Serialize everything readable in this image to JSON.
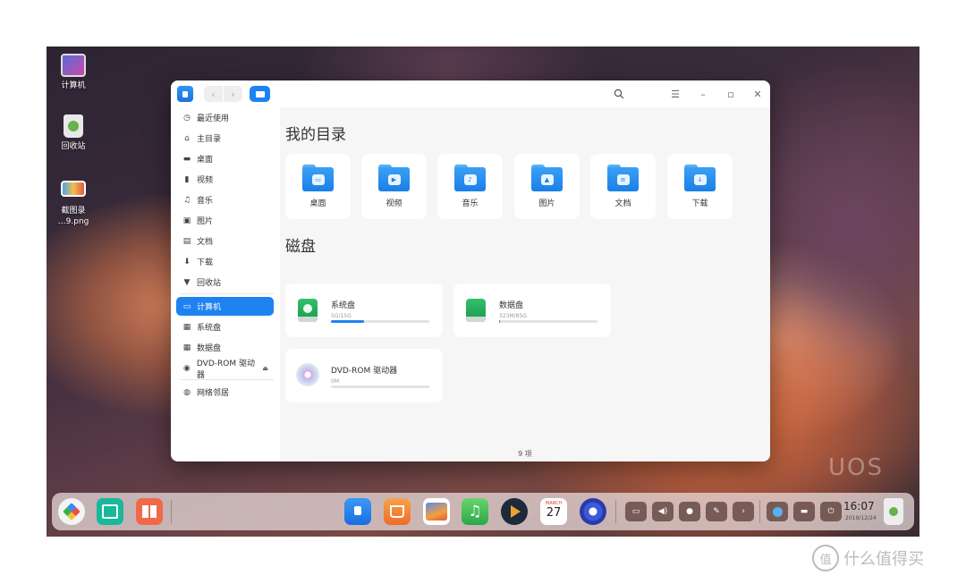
{
  "desktop": {
    "icons": [
      {
        "label": "计算机"
      },
      {
        "label": "回收站"
      },
      {
        "label": "截图录",
        "label2": "…9.png"
      }
    ],
    "brand": "UOS"
  },
  "window": {
    "search_icon": "search-icon",
    "sidebar": [
      {
        "label": "最近使用",
        "icon": "clock-icon"
      },
      {
        "label": "主目录",
        "icon": "home-icon"
      },
      {
        "label": "桌面",
        "icon": "desktop-icon"
      },
      {
        "label": "视频",
        "icon": "video-icon"
      },
      {
        "label": "音乐",
        "icon": "music-icon"
      },
      {
        "label": "图片",
        "icon": "picture-icon"
      },
      {
        "label": "文档",
        "icon": "document-icon"
      },
      {
        "label": "下载",
        "icon": "download-icon"
      },
      {
        "label": "回收站",
        "icon": "trash-icon"
      },
      {
        "label": "计算机",
        "icon": "computer-icon",
        "active": true
      },
      {
        "label": "系统盘",
        "icon": "disk-icon"
      },
      {
        "label": "数据盘",
        "icon": "disk-icon"
      },
      {
        "label": "DVD-ROM 驱动器",
        "icon": "cdrom-icon"
      },
      {
        "label": "网络邻居",
        "icon": "network-icon"
      }
    ],
    "my_directory_title": "我的目录",
    "directories": [
      {
        "label": "桌面",
        "glyph": "▭"
      },
      {
        "label": "视频",
        "glyph": "▶"
      },
      {
        "label": "音乐",
        "glyph": "♪"
      },
      {
        "label": "图片",
        "glyph": "▲"
      },
      {
        "label": "文档",
        "glyph": "≡"
      },
      {
        "label": "下载",
        "glyph": "↓"
      }
    ],
    "disks_title": "磁盘",
    "disks": [
      {
        "name": "系统盘",
        "size": "5G/15G",
        "usage": 0.34
      },
      {
        "name": "数据盘",
        "size": "323M/85G",
        "usage": 0.004
      },
      {
        "name": "DVD-ROM 驱动器",
        "size": "0M",
        "usage": 0
      }
    ],
    "status": "9 项"
  },
  "dock": {
    "time": "16:07",
    "date": "2019/12/24",
    "calendar_month": "MARCH",
    "calendar_day": "27"
  },
  "watermark": {
    "symbol": "值",
    "text": "什么值得买"
  },
  "colors": {
    "accent": "#1e83f0",
    "folder": "#2b90f0"
  }
}
